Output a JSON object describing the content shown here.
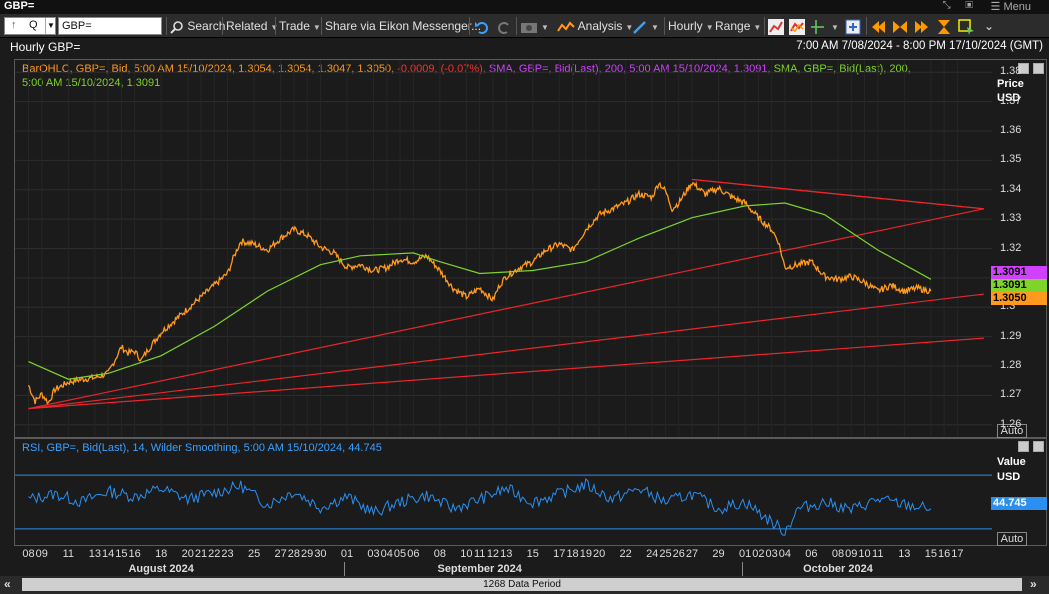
{
  "window": {
    "title": "GBP=",
    "menu_label": "Menu"
  },
  "toolbar": {
    "ric_value": "GBP=",
    "ric_mode": "Q",
    "search_label": "Search",
    "related_label": "Related",
    "trade_label": "Trade",
    "share_label": "Share via Eikon Messenger...",
    "analysis_label": "Analysis",
    "interval_label": "Hourly",
    "range_label": "Range"
  },
  "header": {
    "chart_title": "Hourly GBP=",
    "date_range": "7:00 AM 7/08/2024 - 8:00 PM 17/10/2024 (GMT)"
  },
  "legend": {
    "bar": "BarOHLC, GBP=, Bid, 5:00 AM 15/10/2024, 1.3054, 1.3054, 1.3047, 1.3050,",
    "bar_change": "-0.0009, (-0.07%),",
    "sma1": "SMA, GBP=, Bid(Last),  200,  5:00 AM 15/10/2024, 1.3091,",
    "sma2_a": "SMA, GBP=, Bid(Last),  200,",
    "sma2_b": "5:00 AM 15/10/2024, 1.3091",
    "rsi": "RSI, GBP=, Bid(Last),  14, Wilder Smoothing,  5:00 AM 15/10/2024, 44.745"
  },
  "price_axis": {
    "title": "Price",
    "unit": "USD",
    "auto_label": "Auto"
  },
  "rsi_axis": {
    "title": "Value",
    "unit": "USD",
    "auto_label": "Auto"
  },
  "tags": {
    "sma_magenta": "1.3091",
    "sma_green": "1.3091",
    "last": "1.3050",
    "rsi": "44.745"
  },
  "x_axis": {
    "months": [
      {
        "label": "August 2024",
        "i": 10
      },
      {
        "label": "September 2024",
        "i": 34
      },
      {
        "label": "October 2024",
        "i": 61
      }
    ]
  },
  "scrollbar": {
    "label": "1268 Data Period"
  },
  "colors": {
    "price": "#ff9a1f",
    "sma_green": "#7fd42a",
    "sma_magenta": "#d040ff",
    "trend": "#e8262c",
    "rsi": "#2a8ff0",
    "legend_orange": "#ff9a1f",
    "legend_red": "#ff3030"
  },
  "chart_data": [
    {
      "type": "line",
      "title": "Hourly GBP=",
      "ylabel": "Price USD",
      "ylim": [
        1.2555,
        1.3845
      ],
      "yticks": [
        1.26,
        1.27,
        1.28,
        1.29,
        1.3,
        1.31,
        1.32,
        1.33,
        1.34,
        1.35,
        1.36,
        1.37,
        1.38
      ],
      "x": [
        "08",
        "09",
        "11",
        "13",
        "14",
        "15",
        "16",
        "18",
        "20",
        "21",
        "22",
        "23",
        "25",
        "27",
        "28",
        "29",
        "30",
        "01",
        "03",
        "04",
        "05",
        "06",
        "08",
        "10",
        "11",
        "12",
        "13",
        "15",
        "17",
        "18",
        "19",
        "20",
        "22",
        "24",
        "25",
        "26",
        "27",
        "29",
        "01",
        "02",
        "03",
        "04",
        "06",
        "08",
        "09",
        "10",
        "11",
        "13",
        "15",
        "16",
        "17"
      ],
      "x_index": [
        0,
        1,
        3,
        5,
        6,
        7,
        8,
        10,
        12,
        13,
        14,
        15,
        17,
        19,
        20,
        21,
        22,
        24,
        26,
        27,
        28,
        29,
        31,
        33,
        34,
        35,
        36,
        38,
        40,
        41,
        42,
        43,
        45,
        47,
        48,
        49,
        50,
        52,
        54,
        55,
        56,
        57,
        59,
        61,
        62,
        63,
        64,
        66,
        68,
        69,
        70
      ],
      "series": [
        {
          "name": "BarOHLC GBP= Bid",
          "style": "price",
          "points": [
            [
              0,
              1.2735
            ],
            [
              0.5,
              1.268
            ],
            [
              1,
              1.2705
            ],
            [
              1.5,
              1.2675
            ],
            [
              2,
              1.272
            ],
            [
              3,
              1.2745
            ],
            [
              4,
              1.2755
            ],
            [
              5,
              1.276
            ],
            [
              6,
              1.2775
            ],
            [
              6.5,
              1.282
            ],
            [
              7,
              1.2865
            ],
            [
              7.5,
              1.2845
            ],
            [
              8,
              1.285
            ],
            [
              8.5,
              1.282
            ],
            [
              9,
              1.2855
            ],
            [
              10,
              1.2915
            ],
            [
              11,
              1.2955
            ],
            [
              12,
              1.2995
            ],
            [
              13,
              1.3035
            ],
            [
              14,
              1.3075
            ],
            [
              15,
              1.3115
            ],
            [
              15.5,
              1.3175
            ],
            [
              16,
              1.3225
            ],
            [
              17,
              1.3215
            ],
            [
              18,
              1.3195
            ],
            [
              19,
              1.3235
            ],
            [
              20,
              1.3265
            ],
            [
              21,
              1.3245
            ],
            [
              22,
              1.3205
            ],
            [
              23,
              1.3185
            ],
            [
              24,
              1.3135
            ],
            [
              25,
              1.3145
            ],
            [
              26,
              1.3125
            ],
            [
              27,
              1.3135
            ],
            [
              28,
              1.3165
            ],
            [
              29,
              1.3155
            ],
            [
              30,
              1.3175
            ],
            [
              31,
              1.3125
            ],
            [
              32,
              1.3065
            ],
            [
              33,
              1.3035
            ],
            [
              34,
              1.3065
            ],
            [
              35,
              1.3025
            ],
            [
              35.5,
              1.3075
            ],
            [
              36,
              1.3105
            ],
            [
              37,
              1.3135
            ],
            [
              38,
              1.3155
            ],
            [
              39,
              1.3195
            ],
            [
              40,
              1.3215
            ],
            [
              41,
              1.3195
            ],
            [
              42,
              1.3265
            ],
            [
              43,
              1.3315
            ],
            [
              44,
              1.3335
            ],
            [
              45,
              1.3355
            ],
            [
              46,
              1.3385
            ],
            [
              47,
              1.3375
            ],
            [
              47.5,
              1.3425
            ],
            [
              48,
              1.3395
            ],
            [
              48.5,
              1.3335
            ],
            [
              49,
              1.3355
            ],
            [
              50,
              1.3425
            ],
            [
              51,
              1.3385
            ],
            [
              52,
              1.3405
            ],
            [
              53,
              1.3375
            ],
            [
              54,
              1.3355
            ],
            [
              55,
              1.3305
            ],
            [
              56,
              1.3265
            ],
            [
              56.5,
              1.3225
            ],
            [
              57,
              1.3135
            ],
            [
              58,
              1.3145
            ],
            [
              59,
              1.3155
            ],
            [
              60,
              1.3105
            ],
            [
              61,
              1.3095
            ],
            [
              62,
              1.3105
            ],
            [
              63,
              1.3085
            ],
            [
              64,
              1.3055
            ],
            [
              65,
              1.3075
            ],
            [
              66,
              1.3055
            ],
            [
              67,
              1.3065
            ],
            [
              68,
              1.3055
            ]
          ]
        },
        {
          "name": "SMA 200",
          "style": "sma_green",
          "points": [
            [
              0,
              1.2815
            ],
            [
              3,
              1.2755
            ],
            [
              6,
              1.2775
            ],
            [
              10,
              1.2835
            ],
            [
              14,
              1.2935
            ],
            [
              18,
              1.3055
            ],
            [
              22,
              1.3145
            ],
            [
              25,
              1.3175
            ],
            [
              29,
              1.3185
            ],
            [
              31,
              1.3155
            ],
            [
              34,
              1.3115
            ],
            [
              38,
              1.3125
            ],
            [
              42,
              1.3155
            ],
            [
              46,
              1.3235
            ],
            [
              50,
              1.3305
            ],
            [
              54,
              1.3345
            ],
            [
              57,
              1.3355
            ],
            [
              60,
              1.3315
            ],
            [
              64,
              1.3195
            ],
            [
              68,
              1.3095
            ]
          ]
        }
      ],
      "trendlines": [
        [
          [
            0,
            1.2655
          ],
          [
            72,
            1.3335
          ]
        ],
        [
          [
            0,
            1.2655
          ],
          [
            72,
            1.2895
          ]
        ],
        [
          [
            50,
            1.3435
          ],
          [
            72,
            1.3335
          ]
        ],
        [
          [
            50,
            1.3435
          ],
          [
            72,
            1.3335
          ]
        ],
        [
          [
            0,
            1.2655
          ],
          [
            72,
            1.3045
          ]
        ]
      ]
    },
    {
      "type": "line",
      "title": "RSI 14",
      "ylabel": "Value USD",
      "ylim": [
        18,
        85
      ],
      "levels": [
        70,
        30
      ],
      "series": [
        {
          "name": "RSI 14 Wilder",
          "style": "rsi",
          "last": 44.745,
          "points": [
            [
              0,
              52
            ],
            [
              2,
              56
            ],
            [
              4,
              50
            ],
            [
              6,
              58
            ],
            [
              8,
              54
            ],
            [
              10,
              60
            ],
            [
              12,
              52
            ],
            [
              14,
              57
            ],
            [
              16,
              62
            ],
            [
              18,
              48
            ],
            [
              20,
              58
            ],
            [
              22,
              46
            ],
            [
              24,
              54
            ],
            [
              26,
              42
            ],
            [
              28,
              50
            ],
            [
              30,
              55
            ],
            [
              32,
              45
            ],
            [
              34,
              52
            ],
            [
              36,
              60
            ],
            [
              38,
              50
            ],
            [
              40,
              56
            ],
            [
              42,
              63
            ],
            [
              44,
              52
            ],
            [
              46,
              60
            ],
            [
              48,
              50
            ],
            [
              50,
              56
            ],
            [
              52,
              45
            ],
            [
              54,
              50
            ],
            [
              56,
              35
            ],
            [
              57,
              28
            ],
            [
              58,
              45
            ],
            [
              60,
              50
            ],
            [
              62,
              44
            ],
            [
              64,
              52
            ],
            [
              66,
              48
            ],
            [
              68,
              45
            ]
          ]
        }
      ]
    }
  ]
}
